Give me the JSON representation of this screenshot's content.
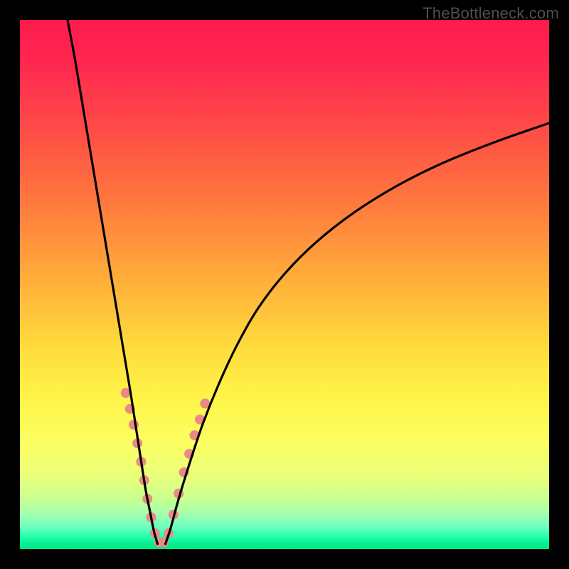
{
  "watermark": "TheBottleneck.com",
  "chart_data": {
    "type": "line",
    "title": "",
    "xlabel": "",
    "ylabel": "",
    "xlim": [
      0,
      100
    ],
    "ylim": [
      0,
      100
    ],
    "gradient_stops": [
      {
        "offset": 0.0,
        "color": "#ff1a4d"
      },
      {
        "offset": 0.08,
        "color": "#ff2750"
      },
      {
        "offset": 0.2,
        "color": "#ff4a47"
      },
      {
        "offset": 0.35,
        "color": "#ff7a3d"
      },
      {
        "offset": 0.5,
        "color": "#ffb13a"
      },
      {
        "offset": 0.62,
        "color": "#ffdc3c"
      },
      {
        "offset": 0.72,
        "color": "#fff54a"
      },
      {
        "offset": 0.8,
        "color": "#fbff62"
      },
      {
        "offset": 0.86,
        "color": "#eaff78"
      },
      {
        "offset": 0.905,
        "color": "#caff90"
      },
      {
        "offset": 0.935,
        "color": "#a0ffb0"
      },
      {
        "offset": 0.958,
        "color": "#6effc0"
      },
      {
        "offset": 0.975,
        "color": "#2bffb0"
      },
      {
        "offset": 0.99,
        "color": "#00f090"
      },
      {
        "offset": 1.0,
        "color": "#00e884"
      }
    ],
    "series": [
      {
        "name": "bottleneck-left",
        "color": "#000000",
        "x": [
          9.0,
          10.5,
          12.0,
          13.5,
          15.0,
          16.5,
          18.0,
          19.5,
          21.0,
          22.0,
          23.0,
          23.8,
          24.6,
          25.3,
          26.0
        ],
        "y": [
          100.0,
          92.0,
          83.0,
          74.0,
          65.0,
          56.0,
          47.0,
          38.0,
          29.0,
          22.5,
          16.0,
          11.0,
          7.0,
          3.5,
          1.0
        ]
      },
      {
        "name": "bottleneck-right",
        "color": "#000000",
        "x": [
          27.5,
          28.5,
          30.0,
          32.0,
          34.5,
          37.5,
          41.0,
          45.0,
          50.0,
          56.0,
          63.0,
          71.0,
          80.0,
          90.0,
          100.0
        ],
        "y": [
          1.0,
          4.0,
          9.5,
          16.0,
          23.5,
          31.0,
          38.5,
          45.5,
          52.0,
          58.0,
          63.5,
          68.5,
          73.0,
          77.0,
          80.5
        ]
      }
    ],
    "markers": {
      "name": "highlight-dots",
      "color": "#e98b84",
      "radius": 7,
      "points": [
        {
          "x": 20.0,
          "y": 29.5
        },
        {
          "x": 20.8,
          "y": 26.5
        },
        {
          "x": 21.5,
          "y": 23.5
        },
        {
          "x": 22.2,
          "y": 20.0
        },
        {
          "x": 22.9,
          "y": 16.5
        },
        {
          "x": 23.5,
          "y": 13.0
        },
        {
          "x": 24.1,
          "y": 9.5
        },
        {
          "x": 24.8,
          "y": 6.0
        },
        {
          "x": 25.5,
          "y": 3.0
        },
        {
          "x": 26.3,
          "y": 1.3
        },
        {
          "x": 27.2,
          "y": 1.3
        },
        {
          "x": 28.1,
          "y": 3.0
        },
        {
          "x": 29.0,
          "y": 6.5
        },
        {
          "x": 30.0,
          "y": 10.5
        },
        {
          "x": 31.0,
          "y": 14.5
        },
        {
          "x": 32.0,
          "y": 18.0
        },
        {
          "x": 33.0,
          "y": 21.5
        },
        {
          "x": 34.0,
          "y": 24.5
        },
        {
          "x": 35.0,
          "y": 27.5
        }
      ]
    }
  }
}
